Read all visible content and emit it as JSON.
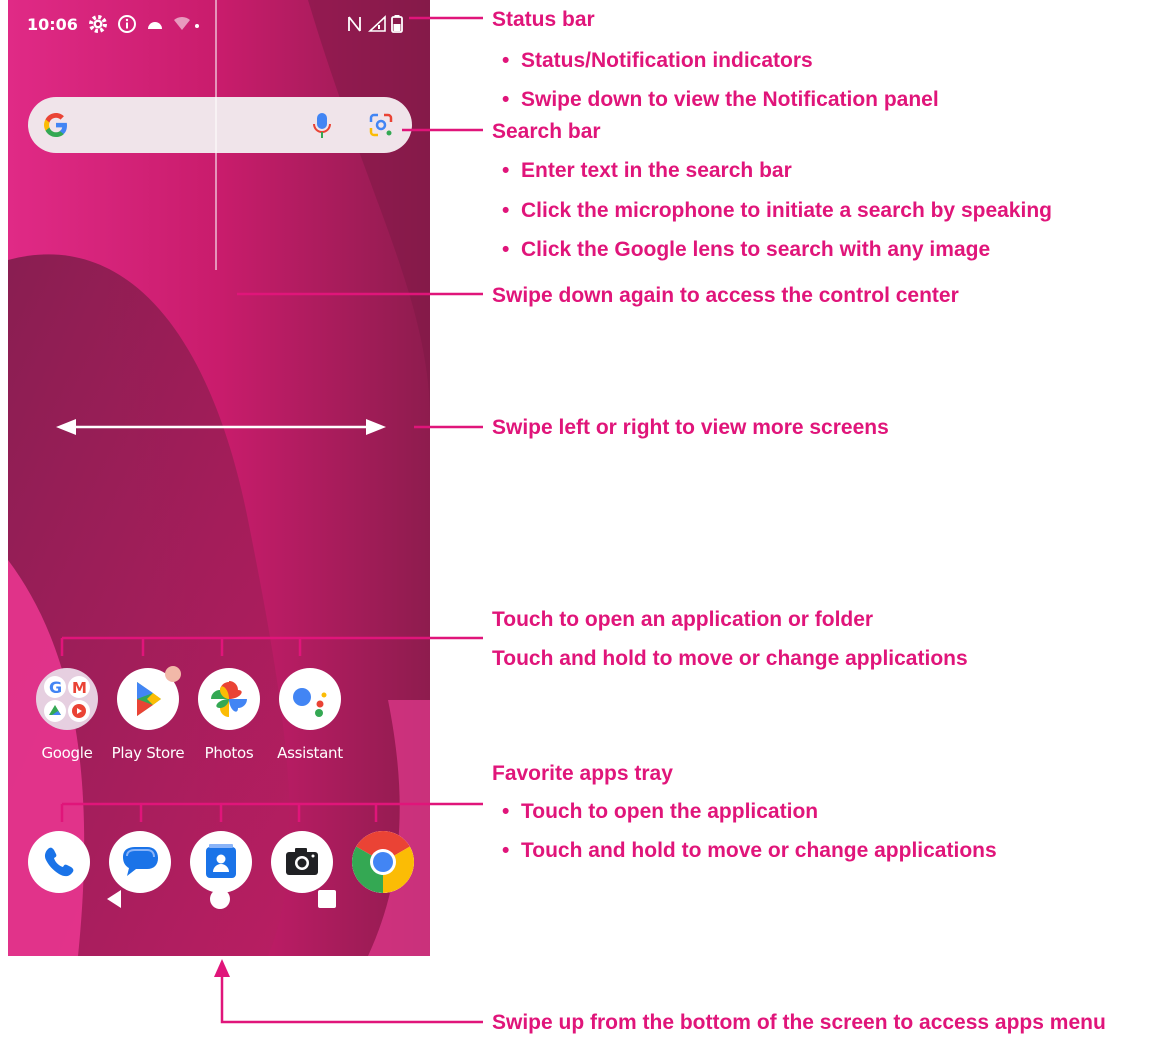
{
  "status_bar": {
    "time": "10:06"
  },
  "apps": [
    {
      "label": "Google"
    },
    {
      "label": "Play Store"
    },
    {
      "label": "Photos"
    },
    {
      "label": "Assistant"
    }
  ],
  "annotations": {
    "status_bar": {
      "title": "Status bar",
      "items": [
        "Status/Notification indicators",
        "Swipe down to view the Notification panel"
      ]
    },
    "search_bar": {
      "title": "Search bar",
      "items": [
        "Enter text in the search bar",
        "Click the microphone to initiate a search by speaking",
        "Click the Google lens to search with any image"
      ]
    },
    "control_center": "Swipe down again to access the control center",
    "more_screens": "Swipe left or right to view more screens",
    "app_folder": [
      "Touch to open an application or folder",
      "Touch and hold to move or change applications"
    ],
    "favorites": {
      "title": "Favorite apps tray",
      "items": [
        "Touch to open the application",
        "Touch and hold to move or change applications"
      ]
    },
    "apps_menu": "Swipe up from the bottom of the screen to access apps menu"
  },
  "colors": {
    "accent": "#e0157a",
    "wallpaper": "#d01e72"
  }
}
